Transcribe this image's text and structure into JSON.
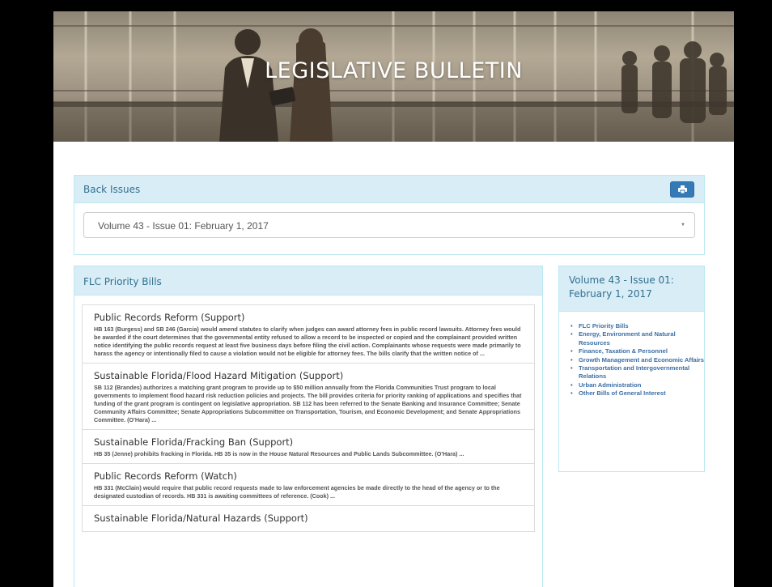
{
  "banner": {
    "title": "LEGISLATIVE BULLETIN"
  },
  "back_issues": {
    "heading": "Back Issues",
    "print_icon": "print-icon",
    "selected_issue": "Volume 43 - Issue 01: February 1, 2017"
  },
  "priority_bills": {
    "heading": "FLC Priority Bills",
    "items": [
      {
        "title": "Public Records Reform (Support)",
        "text": "HB 163 (Burgess) and SB 246 (Garcia) would amend statutes to clarify when judges can award attorney fees in public record lawsuits. Attorney fees would be awarded if the court determines that the governmental entity refused to allow a record to be inspected or copied and the complainant provided written notice identifying the public records request at least five business days before filing the civil action.  Complainants whose requests were made primarily to harass the agency or intentionally filed to cause a violation would not be eligible for attorney fees. The bills clarify that the written notice of ..."
      },
      {
        "title": "Sustainable Florida/Flood Hazard Mitigation (Support)",
        "text": "SB 112 (Brandes) authorizes a matching grant program to provide up to $50 million annually from the Florida Communities Trust program to local governments to implement flood hazard risk reduction policies and projects. The bill provides criteria for priority ranking of applications and specifies that funding of the grant program is contingent on legislative appropriation. SB 112 has been referred to the Senate Banking and Insurance Committee; Senate Community Affairs Committee; Senate Appropriations Subcommittee on Transportation, Tourism, and Economic Development; and Senate Appropriations Committee. (O'Hara) ..."
      },
      {
        "title": "Sustainable Florida/Fracking Ban (Support)",
        "text": "HB 35 (Jenne) prohibits fracking in Florida. HB 35 is now in the House Natural Resources and Public Lands Subcommittee. (O'Hara) ..."
      },
      {
        "title": "Public Records Reform (Watch)",
        "text": "HB 331 (McClain) would require that public record requests made to law enforcement agencies be made directly to the head of the agency or to the designated custodian of records. HB 331 is awaiting committees of reference. (Cook) ..."
      },
      {
        "title": "Sustainable Florida/Natural Hazards (Support)",
        "text": ""
      }
    ]
  },
  "sidebar": {
    "heading": "Volume 43 - Issue 01: February 1, 2017",
    "links": [
      "FLC Priority Bills",
      "Energy, Environment and Natural Resources",
      "Finance, Taxation & Personnel",
      "Growth Management and Economic Affairs",
      "Transportation and Intergovernmental Relations",
      "Urban Administration",
      "Other Bills of General Interest"
    ]
  }
}
